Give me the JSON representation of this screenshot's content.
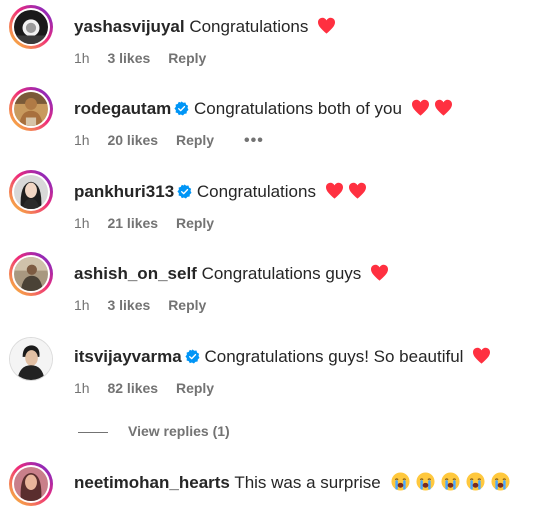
{
  "comments": [
    {
      "username": "yashasvijuyal",
      "text": "Congratulations",
      "verified": false,
      "hearts": 1,
      "time": "1h",
      "likes": "3 likes",
      "reply": "Reply"
    },
    {
      "username": "rodegautam",
      "text": "Congratulations both of you",
      "verified": true,
      "hearts": 2,
      "time": "1h",
      "likes": "20 likes",
      "reply": "Reply",
      "more": "•••"
    },
    {
      "username": "pankhuri313",
      "text": "Congratulations",
      "verified": true,
      "hearts": 2,
      "time": "1h",
      "likes": "21 likes",
      "reply": "Reply"
    },
    {
      "username": "ashish_on_self",
      "text": "Congratulations guys",
      "verified": false,
      "hearts": 1,
      "time": "1h",
      "likes": "3 likes",
      "reply": "Reply"
    },
    {
      "username": "itsvijayvarma",
      "text": "Congratulations guys! So beautiful",
      "verified": true,
      "hearts": 1,
      "time": "1h",
      "likes": "82 likes",
      "reply": "Reply"
    },
    {
      "username": "neetimohan_hearts",
      "text": "This was a surprise",
      "verified": false,
      "emoji": "loudly-crying-face-icon",
      "emoji_count": 5
    }
  ],
  "view_replies": "View replies (1)",
  "colors": {
    "heart": "#ff3040",
    "verified": "#0095f6",
    "meta": "#737373",
    "text": "#262626"
  }
}
